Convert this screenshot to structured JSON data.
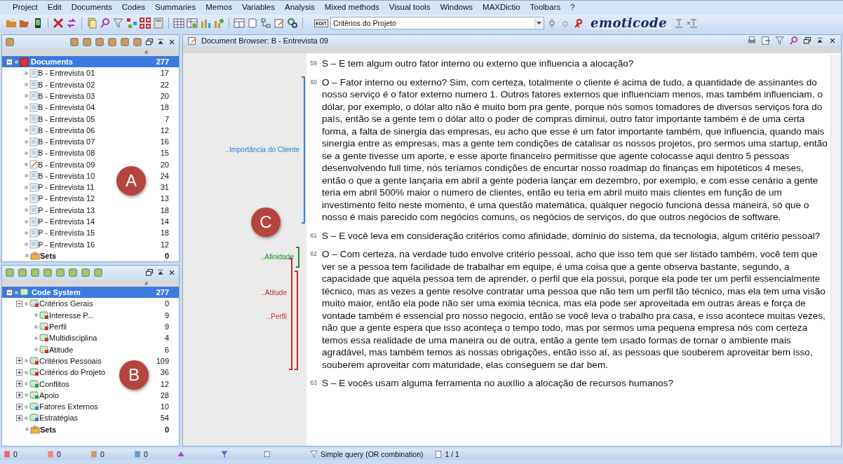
{
  "menu": [
    "Project",
    "Edit",
    "Documents",
    "Codes",
    "Summaries",
    "Memos",
    "Variables",
    "Analysis",
    "Mixed methods",
    "Visual tools",
    "Windows",
    "MAXDictio",
    "Toolbars",
    "?"
  ],
  "toolbar": {
    "edit_badge": "EDIT",
    "code_combo": "Critérios do Projeto",
    "logo": "emoticode"
  },
  "documents_panel": {
    "columns": [
      "#"
    ],
    "root": {
      "label": "Documents",
      "count": "277",
      "selected": true
    },
    "items": [
      {
        "label": "B - Entrevista 01",
        "count": "17",
        "open": false
      },
      {
        "label": "B - Entrevista 02",
        "count": "22",
        "open": false
      },
      {
        "label": "B - Entrevista 03",
        "count": "20",
        "open": false
      },
      {
        "label": "B - Entrevista 04",
        "count": "18",
        "open": false
      },
      {
        "label": "B - Entrevista 05",
        "count": "7",
        "open": false
      },
      {
        "label": "B - Entrevista 06",
        "count": "12",
        "open": false
      },
      {
        "label": "B - Entrevista 07",
        "count": "16",
        "open": false
      },
      {
        "label": "B - Entrevista 08",
        "count": "15",
        "open": false
      },
      {
        "label": "B - Entrevista 09",
        "count": "20",
        "open": true
      },
      {
        "label": "B - Entrevista 10",
        "count": "24",
        "open": false
      },
      {
        "label": "P - Entrevista 11",
        "count": "31",
        "open": false
      },
      {
        "label": "P - Entrevista 12",
        "count": "13",
        "open": false
      },
      {
        "label": "P - Entrevista 13",
        "count": "18",
        "open": false
      },
      {
        "label": "P - Entrevista 14",
        "count": "14",
        "open": false
      },
      {
        "label": "P - Entrevista 15",
        "count": "18",
        "open": false
      },
      {
        "label": "P - Entrevista 16",
        "count": "12",
        "open": false
      }
    ],
    "sets": {
      "label": "Sets",
      "count": "0"
    }
  },
  "code_panel": {
    "columns": [
      "#"
    ],
    "root": {
      "label": "Code System",
      "count": "277",
      "selected": true
    },
    "items": [
      {
        "label": "Critérios Gerais",
        "count": "0",
        "color": "#d03030",
        "expanded": true,
        "children": [
          {
            "label": "Interesse P...",
            "count": "9",
            "color": "#d03030"
          },
          {
            "label": "Perfil",
            "count": "9",
            "color": "#d03030"
          },
          {
            "label": "Multidisciplina",
            "count": "4",
            "color": "#d03030"
          },
          {
            "label": "Atitude",
            "count": "6",
            "color": "#d03030"
          }
        ]
      },
      {
        "label": "Critérios Pessoais",
        "count": "109",
        "color": "#d03030",
        "expanded": false
      },
      {
        "label": "Critérios do Projeto",
        "count": "36",
        "color": "#d03030",
        "expanded": false
      },
      {
        "label": "Conflitos",
        "count": "12",
        "color": "#20a040",
        "expanded": false
      },
      {
        "label": "Apoio",
        "count": "28",
        "color": "#20a040",
        "expanded": false
      },
      {
        "label": "Fatores Externos",
        "count": "10",
        "color": "#3080d0",
        "expanded": false
      },
      {
        "label": "Estratégias",
        "count": "54",
        "color": "#3080d0",
        "expanded": false
      }
    ],
    "sets": {
      "label": "Sets",
      "count": "0"
    }
  },
  "document_browser": {
    "title": "Document Browser: B - Entrevista 09",
    "paragraphs": [
      {
        "number": "59",
        "text": "S – E tem algum outro fator interno ou externo que influencia a alocação?"
      },
      {
        "number": "60",
        "text": "O – Fator interno ou externo? Sim, com certeza, totalmente o cliente é acima de tudo, a quantidade de assinantes do nosso serviço é o fator externo numero 1. Outros fatores externos que influenciam menos, mas também influenciam, o dólar, por exemplo, o dólar alto não é muito bom pra gente, porque nós somos tomadores de diversos serviços fora do país, então se a gente tem o dólar alto o poder de compras diminui, outro fator importante também é de uma certa forma, a falta de sinergia das empresas, eu acho que esse é um fator importante também, que influencia, quando mais sinergia entre as empresas, mas a gente tem condições de catalisar os nossos projetos, pro sermos uma startup, então se a gente tivesse um aporte, e esse aporte financeiro permitisse que  agente colocasse aqui dentro 5 pessoas desenvolvendo full time, nós teríamos condições de encurtar nosso roadmap do finanças em hipotéticos 4 meses, então o que a gente lançaria em abril a gente poderia lançar em dezembro, por exemplo, e com esse cenário a gente teria em abril 500% maior o numero de clientes, então eu teria em abril muito mais clientes em função de um investimento feito neste momento, é uma questão matemática, qualquer negocio funciona dessa maneira, só que o nosso é mais parecido com negócios comuns, os negócios de serviços, do que outros negócios de software.",
        "codes": [
          {
            "label": "..Importância do Cliente",
            "color": "#3080d0",
            "kind": "long"
          }
        ]
      },
      {
        "number": "61",
        "text": "S – E você leva em consideração critérios como afinidade, domínio do sistema, da tecnologia, algum critério pessoal?"
      },
      {
        "number": "62",
        "text": "O – Com certeza, na verdade tudo envolve critério pessoal, acho que isso tem que ser listado também, você tem que ver se a pessoa tem facilidade de trabalhar em equipe, é uma coisa que a gente observa bastante, segundo, a capacidade que aquela pessoa tem de aprender, o perfil que ela possui, porque ela pode ter um perfil essencialmente técnico, mas as vezes a gente resolve contratar uma pessoa que não tem um perfil tão técnico, mas ela tem uma visão muito maior, então ela pode não ser uma eximia  técnica, mas ela pode ser aproveitada em outras áreas e força de vontade também é essencial pro nosso negocio, então se você leva o trabalho pra casa, e isso acontece muitas vezes, não que a gente espera que isso aconteça o tempo todo, mas por sermos uma pequena empresa nós com certeza temos essa realidade de uma maneira ou de outra, então a gente tem usado formas de tornar o ambiente mais agradável, mas também temos as nossas obrigações, então isso aí, as pessoas que souberem aproveitar bem isso, souberem aproveitar com maturidade, elas conseguem se dar bem.",
        "codes": [
          {
            "label": "..Afinidade",
            "color": "#209020",
            "kind": "short"
          },
          {
            "label": "..Atitude",
            "color": "#c03030",
            "kind": "long"
          },
          {
            "label": "..Perfil",
            "color": "#c03030",
            "kind": "long"
          }
        ]
      },
      {
        "number": "63",
        "text": "S – E vocês usam alguma ferramenta no auxílio a alocação de recursos humanos?"
      }
    ]
  },
  "status_bar": {
    "counters": [
      "0",
      "0",
      "0",
      "0"
    ],
    "query": "Simple query (OR combination)",
    "pages": "1 / 1"
  },
  "annotations": [
    {
      "label": "A"
    },
    {
      "label": "B"
    },
    {
      "label": "C"
    }
  ]
}
